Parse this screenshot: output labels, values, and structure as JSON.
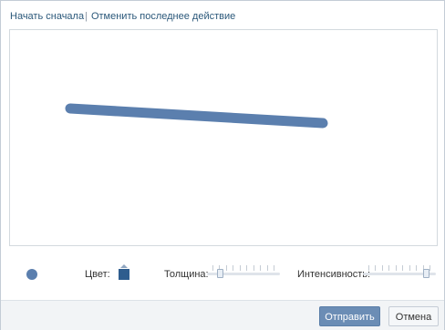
{
  "toolbar": {
    "start_over": "Начать сначала",
    "separator": "|",
    "undo": "Отменить последнее действие"
  },
  "canvas": {
    "stroke_color": "#5b7fae"
  },
  "controls": {
    "color_label": "Цвет:",
    "thickness_label": "Толщина:",
    "intensity_label": "Интенсивность:",
    "selected_color": "#2f5d8e",
    "thickness_level": 0.15,
    "intensity_level": 0.9
  },
  "footer": {
    "send_label": "Отправить",
    "cancel_label": "Отмена"
  },
  "colors": {
    "link": "#2b587a",
    "primary_button": "#6b8db5",
    "footer_bg": "#f2f4f6",
    "border": "#c4ccd6"
  }
}
